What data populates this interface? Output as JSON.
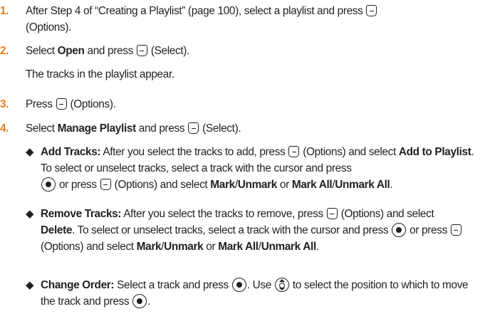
{
  "colors": {
    "step_number": "#e97d1e",
    "text": "#231f20"
  },
  "icons": {
    "softkey": "left-softkey-icon",
    "center": "center-select-key-icon",
    "navigation": "navigation-key-icon"
  },
  "steps": [
    {
      "number": "1.",
      "text1": "After Step 4 of “Creating a Playlist” (page 100), select a playlist and press",
      "text2": "(Options)."
    },
    {
      "number": "2.",
      "select": "Select",
      "bold1": "Open",
      "text1": "and press",
      "text2": "(Select).",
      "note": "The tracks in the playlist appear."
    },
    {
      "number": "3.",
      "text1": "Press",
      "text2": "(Options)."
    },
    {
      "number": "4.",
      "select": "Select",
      "bold1": "Manage Playlist",
      "text1": "and press",
      "text2": "(Select)."
    }
  ],
  "bullets": {
    "marker": "◆",
    "add": {
      "title": "Add Tracks:",
      "t1": "After you select the tracks to add, press",
      "t2": "(Options) and select",
      "b1": "Add to Playlist",
      "t3": ". To select or unselect tracks, select a track with the cursor and press",
      "t4": "or press",
      "t5": "(Options) and select",
      "b2": "Mark",
      "slash1": "/",
      "b3": "Unmark",
      "or": "or",
      "b4": "Mark All",
      "slash2": "/",
      "b5": "Unmark All",
      "end": "."
    },
    "remove": {
      "title": "Remove Tracks:",
      "t1": "After you select the tracks to remove, press",
      "t2": "(Options) and select",
      "b1": "Delete",
      "t3": ". To select or unselect tracks, select a track with the cursor and press",
      "t4": "or press",
      "t5": "(Options) and select",
      "b2": "Mark",
      "slash1": "/",
      "b3": "Unmark",
      "or": "or",
      "b4": "Mark All",
      "slash2": "/",
      "b5": "Unmark All",
      "end": "."
    },
    "order": {
      "title": "Change Order:",
      "t1": "Select a track and press",
      "t2": ". Use",
      "t3": "to select the position to which to move the track and press",
      "end": "."
    }
  }
}
